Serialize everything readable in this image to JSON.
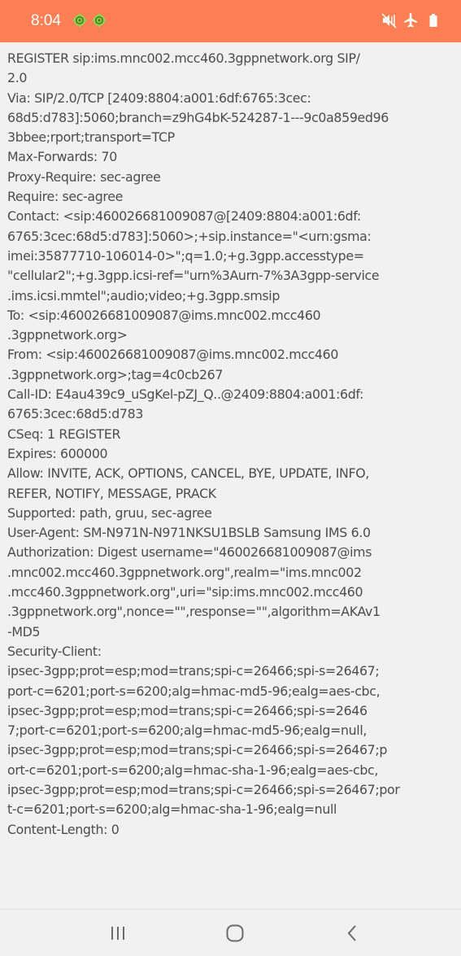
{
  "status_bar": {
    "time": "8:04",
    "background_color": "#ff7f55",
    "left_icons": [
      "android-debug-icon",
      "android-debug-icon"
    ],
    "right_icons": [
      "mute-icon",
      "airplane-icon",
      "battery-icon"
    ]
  },
  "message": {
    "lines": [
      "REGISTER sip:ims.mnc002.mcc460.3gppnetwork.org SIP/",
      "2.0",
      "Via: SIP/2.0/TCP [2409:8804:a001:6df:6765:3cec:",
      "68d5:d783]:5060;branch=z9hG4bK-524287-1---9c0a859ed96",
      "3bbee;rport;transport=TCP",
      "Max-Forwards: 70",
      "Proxy-Require: sec-agree",
      "Require: sec-agree",
      "Contact: <sip:460026681009087@[2409:8804:a001:6df:",
      "6765:3cec:68d5:d783]:5060>;+sip.instance=\"<urn:gsma:",
      "imei:35877710-106014-0>\";q=1.0;+g.3gpp.accesstype=",
      "\"cellular2\";+g.3gpp.icsi-ref=\"urn%3Aurn-7%3A3gpp-service",
      ".ims.icsi.mmtel\";audio;video;+g.3gpp.smsip",
      "To: <sip:460026681009087@ims.mnc002.mcc460",
      ".3gppnetwork.org>",
      "From: <sip:460026681009087@ims.mnc002.mcc460",
      ".3gppnetwork.org>;tag=4c0cb267",
      "Call-ID: E4au439c9_uSgKel-pZJ_Q..@2409:8804:a001:6df:",
      "6765:3cec:68d5:d783",
      "CSeq: 1 REGISTER",
      "Expires: 600000",
      "Allow: INVITE, ACK, OPTIONS, CANCEL, BYE, UPDATE, INFO,",
      "REFER, NOTIFY, MESSAGE, PRACK",
      "Supported: path, gruu, sec-agree",
      "User-Agent: SM-N971N-N971NKSU1BSLB Samsung IMS 6.0",
      "Authorization: Digest username=\"460026681009087@ims",
      ".mnc002.mcc460.3gppnetwork.org\",realm=\"ims.mnc002",
      ".mcc460.3gppnetwork.org\",uri=\"sip:ims.mnc002.mcc460",
      ".3gppnetwork.org\",nonce=\"\",response=\"\",algorithm=AKAv1",
      "-MD5",
      "Security-Client:",
      "ipsec-3gpp;prot=esp;mod=trans;spi-c=26466;spi-s=26467;",
      "port-c=6201;port-s=6200;alg=hmac-md5-96;ealg=aes-cbc,",
      "ipsec-3gpp;prot=esp;mod=trans;spi-c=26466;spi-s=2646",
      "7;port-c=6201;port-s=6200;alg=hmac-md5-96;ealg=null,",
      "ipsec-3gpp;prot=esp;mod=trans;spi-c=26466;spi-s=26467;p",
      "ort-c=6201;port-s=6200;alg=hmac-sha-1-96;ealg=aes-cbc,",
      "ipsec-3gpp;prot=esp;mod=trans;spi-c=26466;spi-s=26467;por",
      "t-c=6201;port-s=6200;alg=hmac-sha-1-96;ealg=null",
      "Content-Length: 0"
    ]
  },
  "nav_bar": {
    "buttons": [
      "recent-apps-icon",
      "home-icon",
      "back-icon"
    ]
  }
}
